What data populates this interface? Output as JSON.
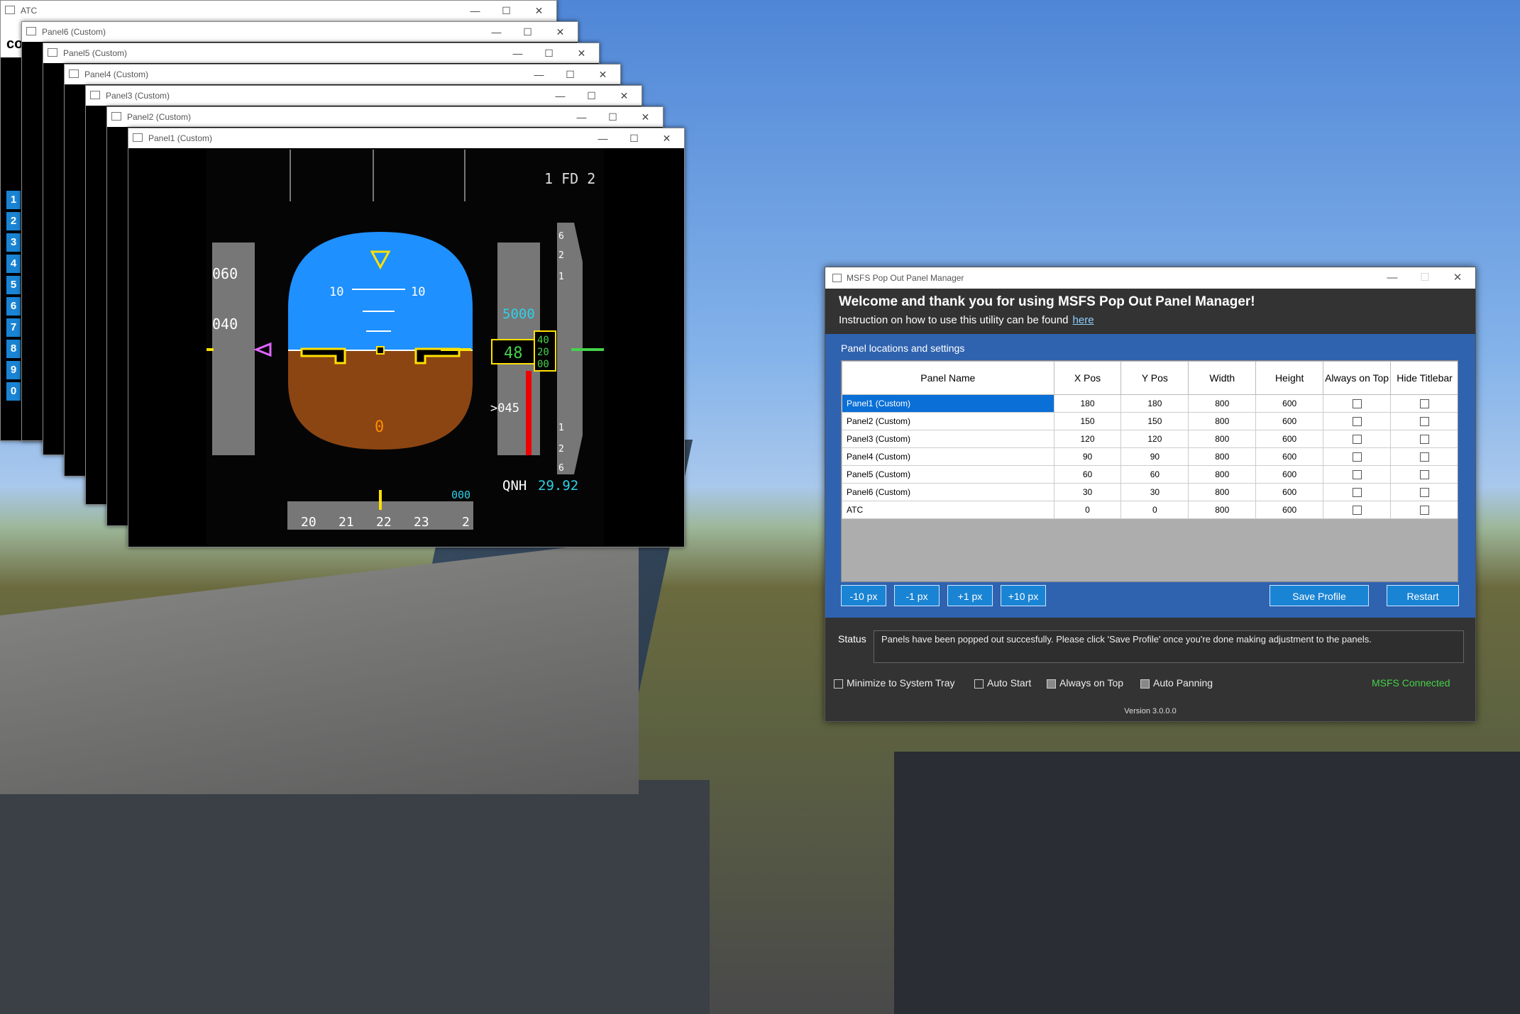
{
  "windows": {
    "atc": {
      "title": "ATC"
    },
    "panel6": {
      "title": "Panel6 (Custom)"
    },
    "panel5": {
      "title": "Panel5 (Custom)"
    },
    "panel4": {
      "title": "Panel4 (Custom)"
    },
    "panel3": {
      "title": "Panel3 (Custom)"
    },
    "panel2": {
      "title": "Panel2 (Custom)"
    },
    "panel1": {
      "title": "Panel1 (Custom)"
    },
    "controls": {
      "minimize": "—",
      "maximize": "☐",
      "close": "✕"
    }
  },
  "atc_partial": {
    "text": "co",
    "numbers": [
      "1",
      "2",
      "3",
      "4",
      "5",
      "6",
      "7",
      "8",
      "9",
      "0"
    ]
  },
  "pfd": {
    "fd": "1 FD 2",
    "speed_ticks": [
      "060",
      "040"
    ],
    "alt_target": "5000",
    "alt_current": "48",
    "alt_drum": [
      "40",
      "20",
      "00"
    ],
    "alt_lower": ">045",
    "pitch_labels": [
      "10",
      "10"
    ],
    "roll_zero": "0",
    "qnh_label": "QNH",
    "qnh_value": "29.92",
    "vs_scale": [
      "6",
      "2",
      "1",
      "1",
      "2",
      "6"
    ],
    "heading_ticks": [
      "20",
      "21",
      "22",
      "23",
      "2"
    ],
    "heading_sel": "000"
  },
  "manager": {
    "title": "MSFS Pop Out Panel Manager",
    "welcome": "Welcome and thank you for using MSFS Pop Out Panel Manager!",
    "instruction": "Instruction on how to use this utility can be found",
    "instruction_link": "here",
    "section_title": "Panel locations and settings",
    "columns": [
      "Panel Name",
      "X Pos",
      "Y Pos",
      "Width",
      "Height",
      "Always on Top",
      "Hide Titlebar"
    ],
    "rows": [
      {
        "name": "Panel1 (Custom)",
        "x": "180",
        "y": "180",
        "w": "800",
        "h": "600"
      },
      {
        "name": "Panel2 (Custom)",
        "x": "150",
        "y": "150",
        "w": "800",
        "h": "600"
      },
      {
        "name": "Panel3 (Custom)",
        "x": "120",
        "y": "120",
        "w": "800",
        "h": "600"
      },
      {
        "name": "Panel4 (Custom)",
        "x": "90",
        "y": "90",
        "w": "800",
        "h": "600"
      },
      {
        "name": "Panel5 (Custom)",
        "x": "60",
        "y": "60",
        "w": "800",
        "h": "600"
      },
      {
        "name": "Panel6 (Custom)",
        "x": "30",
        "y": "30",
        "w": "800",
        "h": "600"
      },
      {
        "name": "ATC",
        "x": "0",
        "y": "0",
        "w": "800",
        "h": "600"
      }
    ],
    "buttons": {
      "m10": "-10 px",
      "m1": "-1 px",
      "p1": "+1 px",
      "p10": "+10 px",
      "save": "Save Profile",
      "restart": "Restart"
    },
    "status_label": "Status",
    "status_text": "Panels have been popped out succesfully. Please click 'Save Profile' once you're done making adjustment to the panels.",
    "options": {
      "tray": "Minimize to System Tray",
      "autostart": "Auto Start",
      "ontop": "Always on Top",
      "panning": "Auto Panning"
    },
    "connection": "MSFS Connected",
    "version": "Version 3.0.0.0"
  },
  "colors": {
    "accent": "#1a84d4",
    "panel_bg": "#2f63b0",
    "connected": "#45d24a",
    "sky": "#1e90ff",
    "ground": "#8b4513"
  }
}
